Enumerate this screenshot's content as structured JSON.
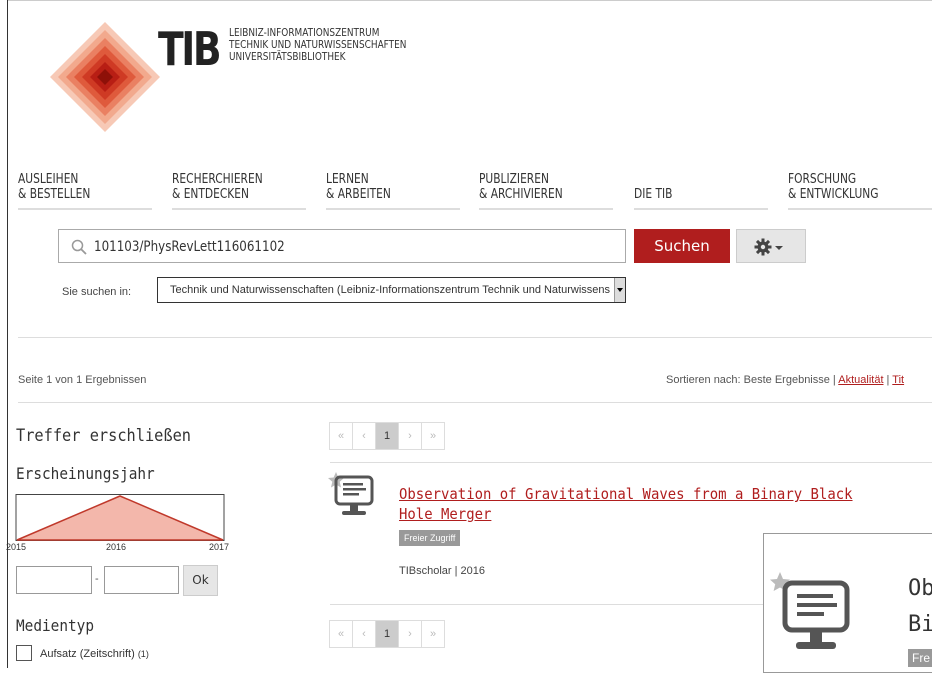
{
  "logo": {
    "letters": "TIB",
    "subtitle_lines": [
      "LEIBNIZ-INFORMATIONSZENTRUM",
      "TECHNIK UND NATURWISSENSCHAFTEN",
      "UNIVERSITÄTSBIBLIOTHEK"
    ]
  },
  "nav": [
    {
      "line1": "AUSLEIHEN",
      "line2": "& BESTELLEN"
    },
    {
      "line1": "RECHERCHIEREN",
      "line2": "& ENTDECKEN"
    },
    {
      "line1": "LERNEN",
      "line2": "& ARBEITEN"
    },
    {
      "line1": "PUBLIZIEREN",
      "line2": "& ARCHIVIEREN"
    },
    {
      "line1": "",
      "line2": "DIE TIB"
    },
    {
      "line1": "FORSCHUNG",
      "line2": "& ENTWICKLUNG"
    }
  ],
  "search": {
    "value": "101103/PhysRevLett116061102",
    "button_label": "Suchen",
    "scope_label": "Sie suchen in:",
    "scope_value": "Technik und Naturwissenschaften (Leibniz-Informationszentrum Technik und Naturwissenschaften)"
  },
  "results_bar": {
    "page_info": "Seite 1 von 1 Ergebnissen",
    "sort_prefix": "Sortieren nach: Beste Ergebnisse | ",
    "sort_link1": "Aktualität",
    "sort_sep": " | ",
    "sort_link2": "Tit"
  },
  "facets": {
    "heading": "Treffer erschließen",
    "year_heading": "Erscheinungsjahr",
    "year_labels": [
      "2015",
      "2016",
      "2017"
    ],
    "year_counts": [
      0,
      1,
      0
    ],
    "range_dash": "-",
    "ok_label": "Ok",
    "media_heading": "Medientyp",
    "media_items": [
      {
        "label": "Aufsatz (Zeitschrift)",
        "count": "(1)"
      }
    ]
  },
  "pager": {
    "first": "«",
    "prev": "‹",
    "page": "1",
    "next": "›",
    "last": "»"
  },
  "result": {
    "title": "Observation of Gravitational Waves from a Binary Black Hole Merger",
    "badge": "Freier Zugriff",
    "source": "TIBscholar | 2016"
  },
  "overlay": {
    "title_line1": "Ob",
    "title_line2": "Bi",
    "badge": "Fre"
  },
  "colors": {
    "accent": "#b01e1e",
    "badge": "#999999"
  }
}
